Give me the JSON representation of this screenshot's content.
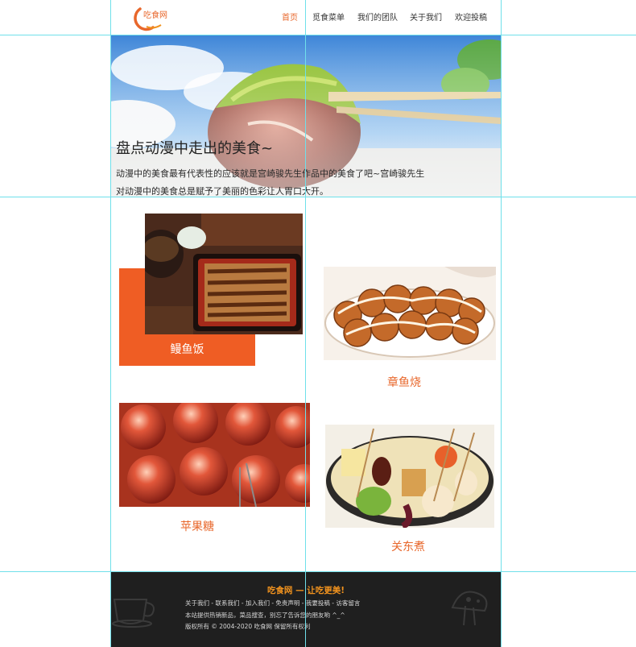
{
  "header": {
    "logo_text": "吃食网",
    "nav": [
      "首页",
      "觅食菜单",
      "我们的团队",
      "关于我们",
      "欢迎投稿"
    ],
    "active_color": "#e8672b"
  },
  "hero": {
    "title": "盘点动漫中走出的美食~",
    "line1": "动漫中的美食最有代表性的应该就是宫崎骏先生作品中的美食了吧~宫崎骏先生",
    "line2": "对动漫中的美食总是赋予了美丽的色彩让人胃口大开。"
  },
  "foods": [
    {
      "name": "鳗鱼饭"
    },
    {
      "name": "章鱼烧"
    },
    {
      "name": "苹果糖"
    },
    {
      "name": "关东煮"
    }
  ],
  "footer": {
    "title": "吃食网 — 让吃更美!",
    "links": "关于我们 - 联系我们 - 加入我们 - 免责声明 - 我要投稿 - 访客留言",
    "line2": "本站提供热销新品，菜品搜查，别忘了告诉您的朋友哟 ^_^",
    "copyright": "版权所有 © 2004-2020 吃食网 保留所有权利"
  },
  "colors": {
    "accent": "#e8672b",
    "guide": "#6fe0ea",
    "footer_bg": "#1f1f1f"
  }
}
